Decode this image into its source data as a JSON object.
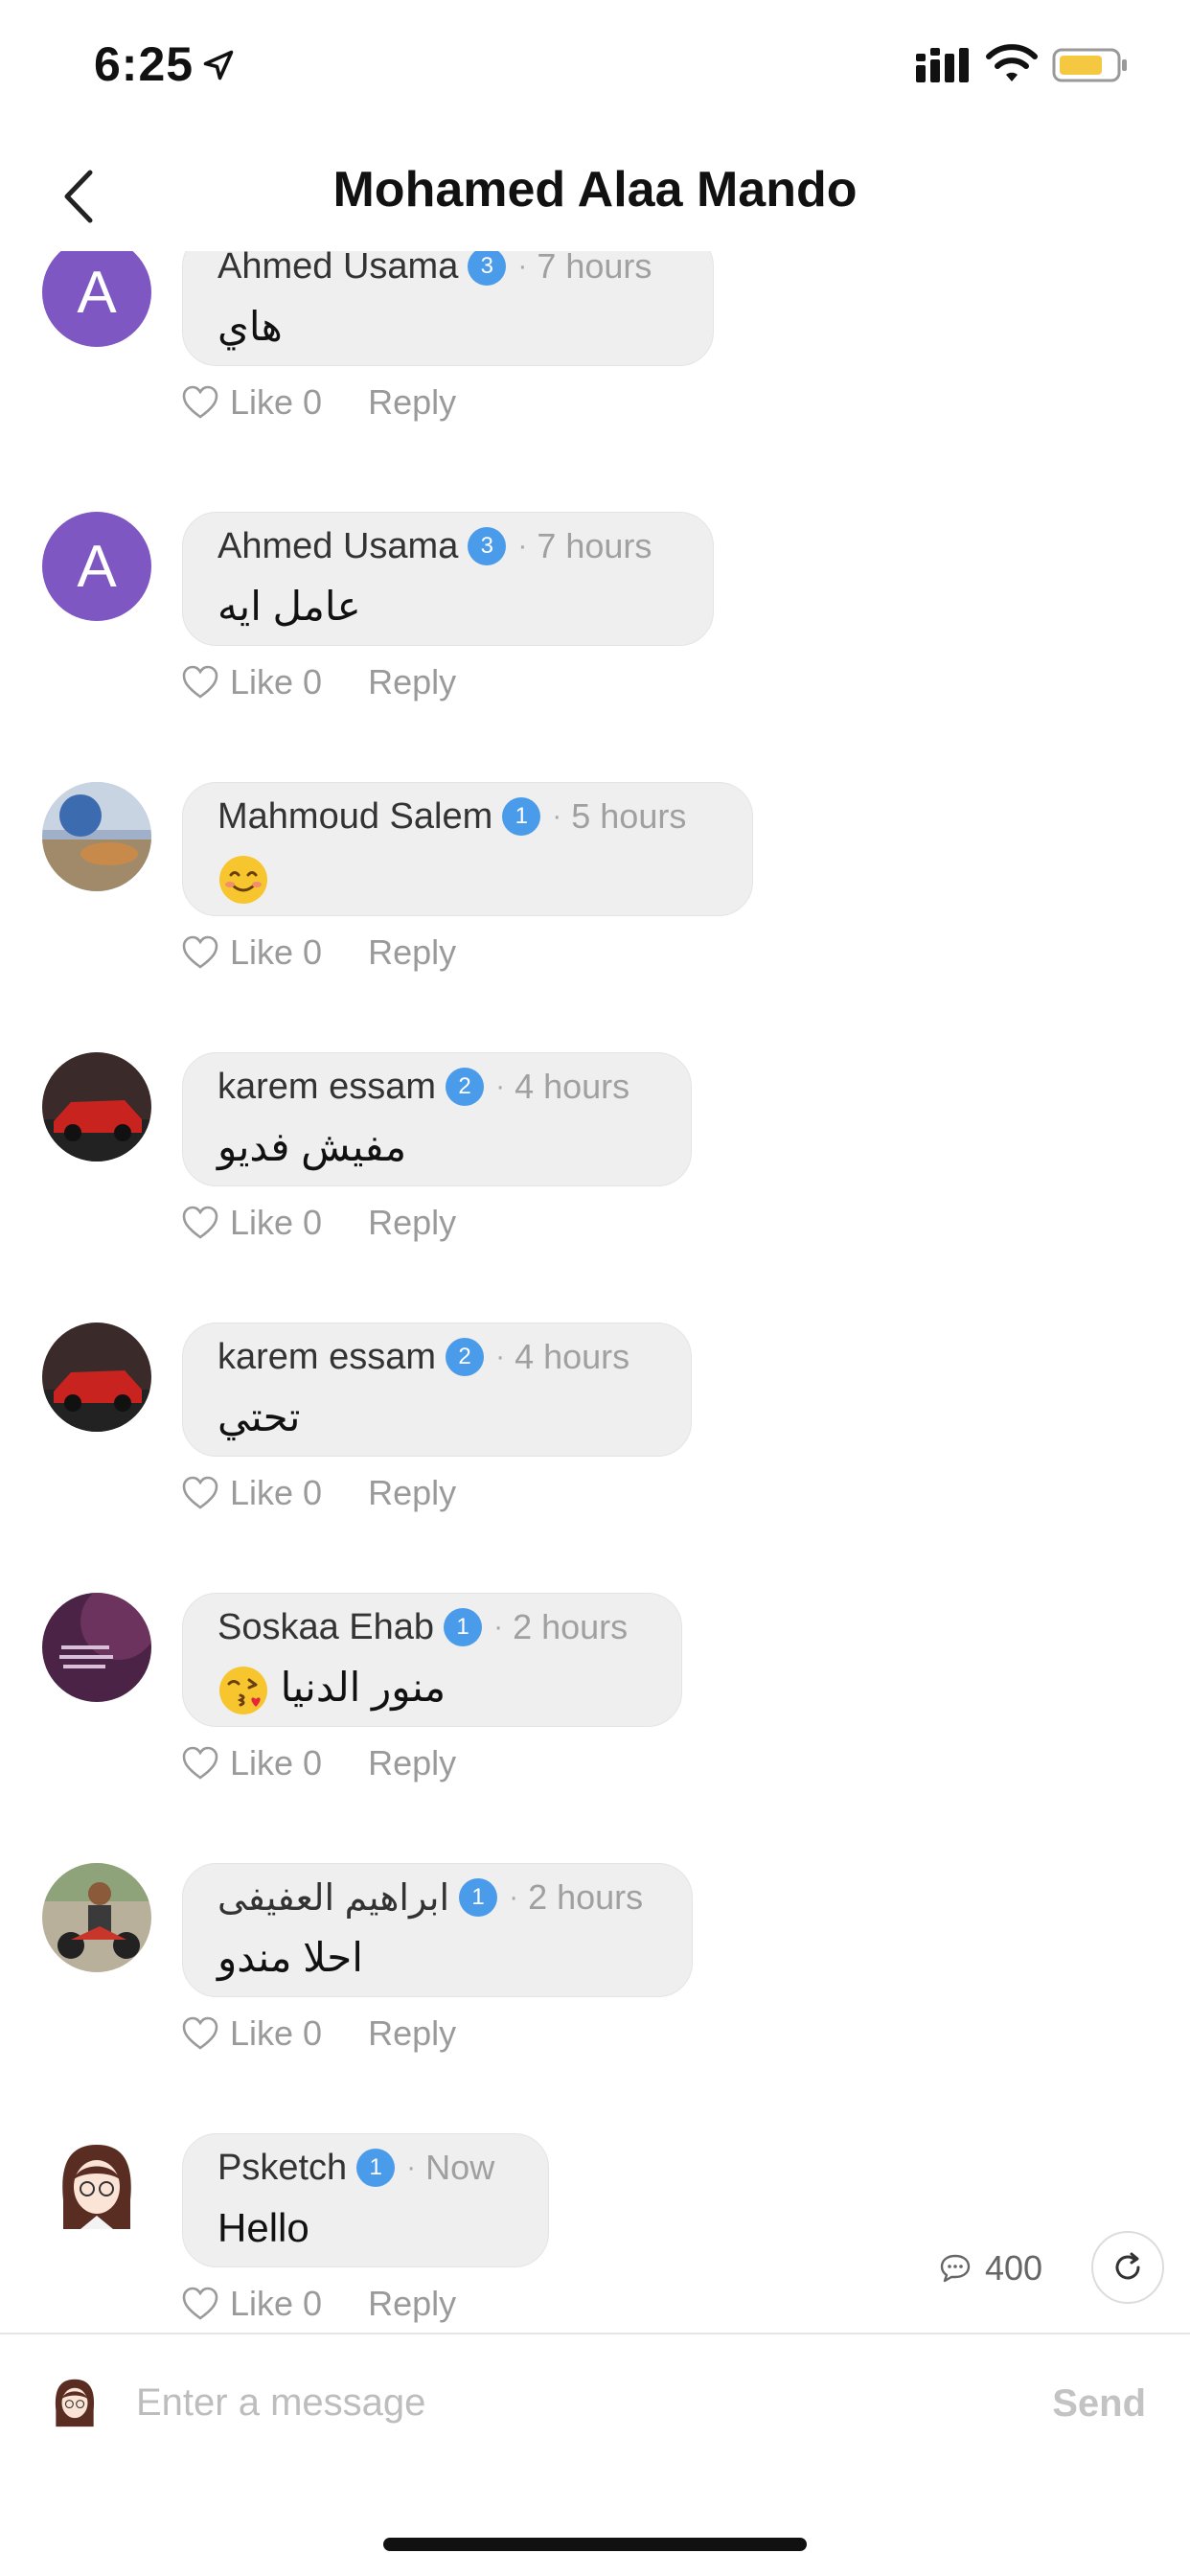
{
  "status_bar": {
    "time": "6:25",
    "icons": [
      "location-arrow-icon",
      "signal-icon",
      "wifi-icon",
      "battery-icon"
    ]
  },
  "header": {
    "title": "Mohamed Alaa Mando",
    "back_icon": "chevron-left-icon"
  },
  "comments": [
    {
      "author": "Ahmed Usama",
      "level": "3",
      "time": "7 hours",
      "text": "هاي",
      "avatar_letter": "A",
      "like_label": "Like",
      "likes": "0",
      "reply_label": "Reply"
    },
    {
      "author": "Ahmed Usama",
      "level": "3",
      "time": "7 hours",
      "text": "عامل ايه",
      "avatar_letter": "A",
      "like_label": "Like",
      "likes": "0",
      "reply_label": "Reply"
    },
    {
      "author": "Mahmoud Salem",
      "level": "1",
      "time": "5 hours",
      "text": "",
      "emoji": "smiling-face-emoji",
      "like_label": "Like",
      "likes": "0",
      "reply_label": "Reply"
    },
    {
      "author": "karem essam",
      "level": "2",
      "time": "4 hours",
      "text": "مفيش فديو",
      "like_label": "Like",
      "likes": "0",
      "reply_label": "Reply"
    },
    {
      "author": "karem essam",
      "level": "2",
      "time": "4 hours",
      "text": "تحتي",
      "like_label": "Like",
      "likes": "0",
      "reply_label": "Reply"
    },
    {
      "author": "Soskaa Ehab",
      "level": "1",
      "time": "2 hours",
      "text": "منور الدنيا",
      "emoji": "kiss-face-emoji",
      "like_label": "Like",
      "likes": "0",
      "reply_label": "Reply"
    },
    {
      "author": "ابراهيم العفيفى",
      "level": "1",
      "time": "2 hours",
      "text": "احلا مندو",
      "like_label": "Like",
      "likes": "0",
      "reply_label": "Reply"
    },
    {
      "author": "Psketch",
      "level": "1",
      "time": "Now",
      "text": "Hello",
      "like_label": "Like",
      "likes": "0",
      "reply_label": "Reply"
    }
  ],
  "comment_count": "400",
  "composer": {
    "placeholder": "Enter a message",
    "send_label": "Send"
  },
  "colors": {
    "badge": "#4a9bea",
    "avatar_letter_bg": "#7e57c2",
    "bubble_bg": "#efeff0"
  }
}
